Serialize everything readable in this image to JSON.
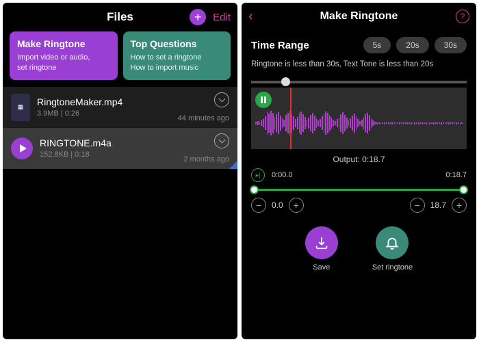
{
  "left": {
    "title": "Files",
    "edit": "Edit",
    "cards": [
      {
        "title": "Make Ringtone",
        "sub": "Import video or audio,\nset ringtone"
      },
      {
        "title": "Top Questions",
        "sub": "How to set a ringtone\nHow to import music"
      }
    ],
    "files": [
      {
        "name": "RingtoneMaker.mp4",
        "meta": "3.9MB | 0:26",
        "time": "44 minutes ago"
      },
      {
        "name": "RINGTONE.m4a",
        "meta": "152.8KB | 0:18",
        "time": "2 months ago"
      }
    ]
  },
  "right": {
    "title": "Make Ringtone",
    "range_label": "Time Range",
    "pills": [
      "5s",
      "20s",
      "30s"
    ],
    "hint": "Ringtone is less than 30s, Text Tone is less than 20s",
    "output_label": "Output: 0:18.7",
    "t_start": "0:00.0",
    "t_end": "0:18.7",
    "trim_start": "0.0",
    "trim_end": "18.7",
    "save": "Save",
    "set": "Set ringtone"
  }
}
